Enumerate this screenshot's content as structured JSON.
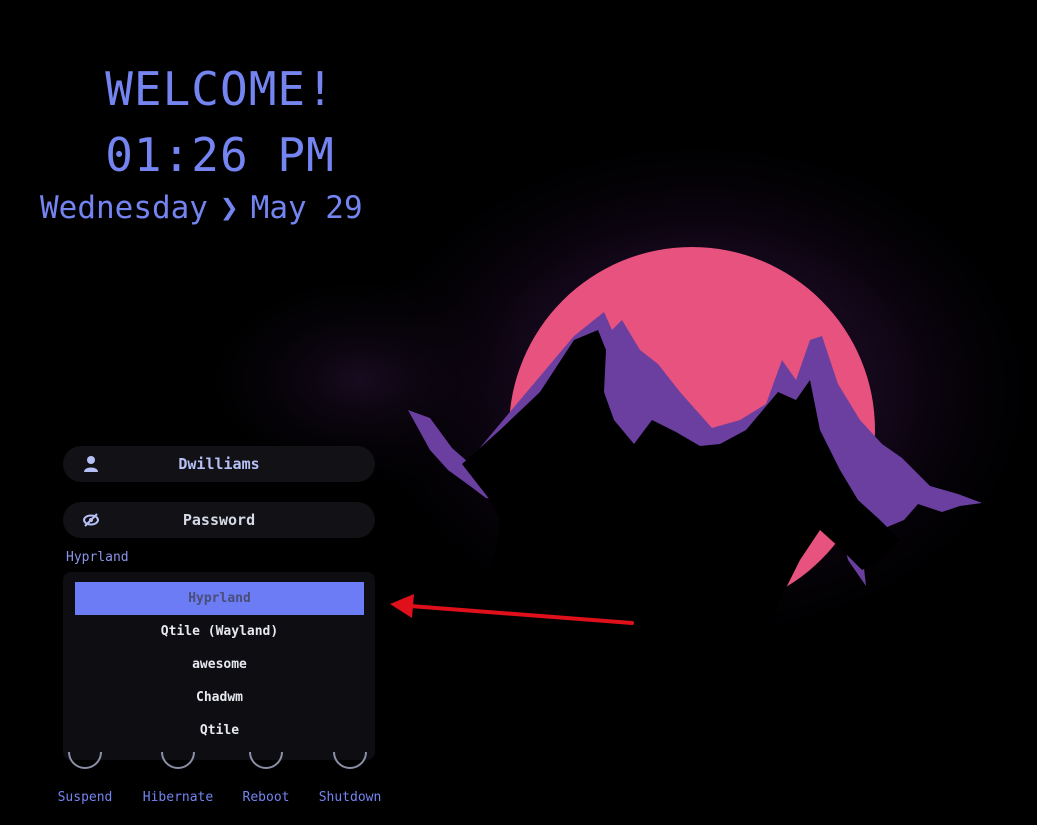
{
  "greeter": {
    "welcome": "WELCOME!",
    "time": "01:26 PM",
    "weekday": "Wednesday",
    "date_separator": "❯",
    "date": "May 29"
  },
  "login": {
    "username": "Dwilliams",
    "password_placeholder": "Password",
    "user_icon": "user-icon",
    "password_icon": "eye-hidden-icon"
  },
  "session": {
    "selected": "Hyprland",
    "options": [
      {
        "label": "Hyprland",
        "active": true
      },
      {
        "label": "Qtile (Wayland)",
        "active": false
      },
      {
        "label": "awesome",
        "active": false
      },
      {
        "label": "Chadwm",
        "active": false
      },
      {
        "label": "Qtile",
        "active": false
      }
    ]
  },
  "power": {
    "suspend": "Suspend",
    "hibernate": "Hibernate",
    "reboot": "Reboot",
    "shutdown": "Shutdown"
  },
  "colors": {
    "background": "#000000",
    "accent": "#7484f0",
    "sun": "#e8527e",
    "mountain_highlight": "#6b3fa0",
    "annotation": "#e0101a"
  }
}
